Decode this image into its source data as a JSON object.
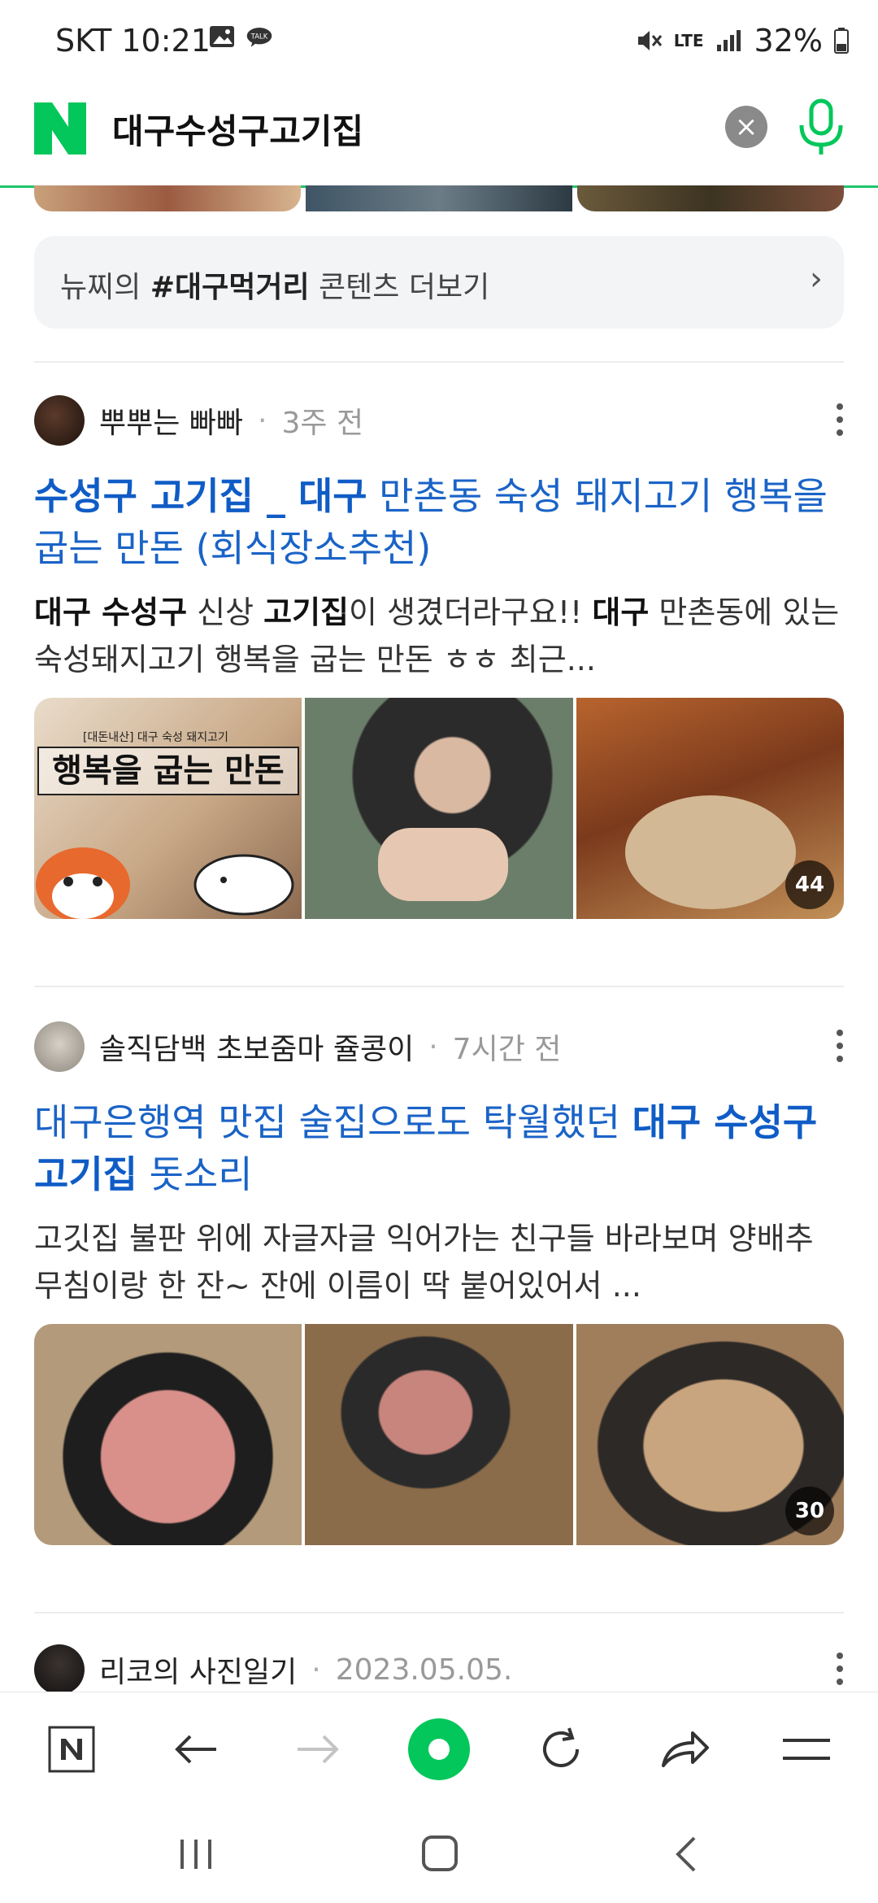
{
  "status_bar": {
    "carrier_time": "SKT 10:21",
    "battery": "32%",
    "network": "LTE"
  },
  "search": {
    "query": "대구수성구고기집",
    "clear_label": "×"
  },
  "more_box": {
    "prefix": "뉴찌의 ",
    "tag": "#대구먹거리",
    "suffix": " 콘텐츠 더보기"
  },
  "posts": [
    {
      "author": "뿌뿌는 빠빠",
      "ago": "3주 전",
      "title_parts": [
        {
          "t": "수성구 고기집 _ 대구",
          "b": true
        },
        {
          "t": " 만촌동 숙성 돼지고기 행복을 굽는 만돈 (회식장소추천)",
          "b": false
        }
      ],
      "desc_parts": [
        {
          "t": "대구 수성구",
          "b": true
        },
        {
          "t": " 신상 ",
          "b": false
        },
        {
          "t": "고기집",
          "b": true
        },
        {
          "t": "이 생겼더라구요!! ",
          "b": false
        },
        {
          "t": "대구",
          "b": true
        },
        {
          "t": " 만촌동에 있는 숙성돼지고기 행복을 굽는 만돈 ㅎㅎ 최근...",
          "b": false
        }
      ],
      "thumb_text_small": "[대돈내산] 대구 숙성 돼지고기",
      "thumb_text_big": "행복을 굽는 만돈",
      "image_count": "44"
    },
    {
      "author": "솔직담백 초보줌마 쥴콩이",
      "ago": "7시간 전",
      "title_parts": [
        {
          "t": "대구은행역 맛집 술집으로도 탁월했던 ",
          "b": false
        },
        {
          "t": "대구 수성구 고기집",
          "b": true
        },
        {
          "t": " 돗소리",
          "b": false
        }
      ],
      "desc_parts": [
        {
          "t": "고깃집 불판 위에 자글자글 익어가는 친구들 바라보며 양배추 무침이랑 한 잔~ 잔에 이름이 딱 붙어있어서 ...",
          "b": false
        }
      ],
      "image_count": "30"
    },
    {
      "author": "리코의 사진일기",
      "ago": "2023.05.05."
    }
  ],
  "colors": {
    "naver_green": "#03c75a",
    "link_blue": "#1a63c7"
  }
}
